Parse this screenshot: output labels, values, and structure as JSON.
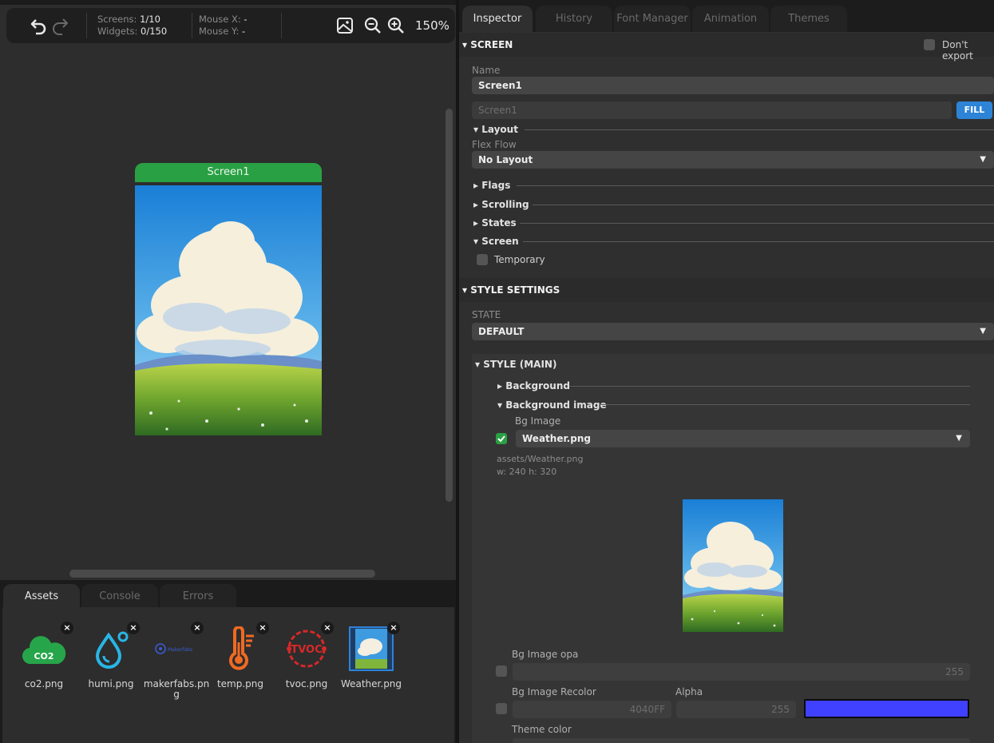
{
  "toolbar": {
    "undo_icon": "undo-icon",
    "redo_icon": "redo-icon",
    "screens_label": "Screens:",
    "screens_value": "1/10",
    "widgets_label": "Widgets:",
    "widgets_value": "0/150",
    "mouse_x_label": "Mouse X:",
    "mouse_x_value": "-",
    "mouse_y_label": "Mouse Y:",
    "mouse_y_value": "-",
    "zoom": "150%"
  },
  "canvas": {
    "screen_title": "Screen1"
  },
  "bottom_tabs": [
    "Assets",
    "Console",
    "Errors"
  ],
  "assets": [
    {
      "name": "co2.png",
      "icon": "co2-icon"
    },
    {
      "name": "humi.png",
      "icon": "humidity-icon"
    },
    {
      "name": "makerfabs.png",
      "icon": "makerfabs-logo"
    },
    {
      "name": "temp.png",
      "icon": "thermometer-icon"
    },
    {
      "name": "tvoc.png",
      "icon": "tvoc-icon"
    },
    {
      "name": "Weather.png",
      "icon": "weather-image"
    }
  ],
  "asset_labels": {
    "co2_text": "CO2",
    "makerfabs_text": "Makerfabs",
    "tvoc_text": "TVOC"
  },
  "inspector": {
    "tabs": [
      "Inspector",
      "History",
      "Font Manager",
      "Animation",
      "Themes"
    ],
    "screen_section": "SCREEN",
    "dont_export": "Don't export",
    "name_label": "Name",
    "name_value": "Screen1",
    "id_value": "Screen1",
    "fill_button": "FILL",
    "layout_label": "Layout",
    "flex_flow_label": "Flex Flow",
    "flex_flow_value": "No Layout",
    "flags_label": "Flags",
    "scrolling_label": "Scrolling",
    "states_label": "States",
    "screen_label": "Screen",
    "temporary_label": "Temporary"
  },
  "style": {
    "section": "STYLE SETTINGS",
    "state_label": "STATE",
    "state_value": "DEFAULT",
    "style_main": "STYLE (MAIN)",
    "background": "Background",
    "background_image": "Background image",
    "bg_image_label": "Bg Image",
    "bg_image_value": "Weather.png",
    "bg_image_path": "assets/Weather.png",
    "bg_image_size": "w: 240  h: 320",
    "bg_image_opa_label": "Bg Image opa",
    "bg_image_opa_value": "255",
    "bg_recolor_label": "Bg Image Recolor",
    "bg_recolor_value": "4040FF",
    "alpha_label": "Alpha",
    "alpha_value": "255",
    "recolor_color": "#4040FF",
    "theme_color_label": "Theme color"
  },
  "colors": {
    "accent_green": "#2aa044",
    "accent_blue": "#2d83d6"
  }
}
